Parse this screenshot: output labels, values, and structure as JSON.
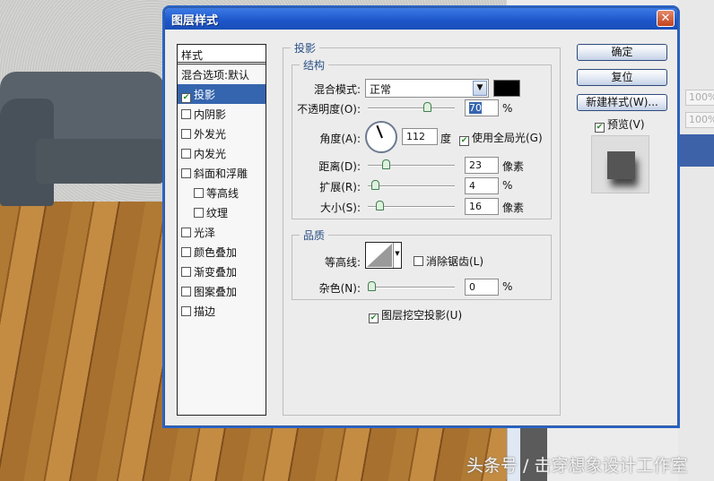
{
  "dialog": {
    "title": "图层样式",
    "close": "✕"
  },
  "styles_list": {
    "header": "样式",
    "items": [
      {
        "label": "混合选项:默认",
        "checkbox": false,
        "checked": false,
        "indent": false,
        "selected": false
      },
      {
        "label": "投影",
        "checkbox": true,
        "checked": true,
        "indent": false,
        "selected": true
      },
      {
        "label": "内阴影",
        "checkbox": true,
        "checked": false,
        "indent": false,
        "selected": false
      },
      {
        "label": "外发光",
        "checkbox": true,
        "checked": false,
        "indent": false,
        "selected": false
      },
      {
        "label": "内发光",
        "checkbox": true,
        "checked": false,
        "indent": false,
        "selected": false
      },
      {
        "label": "斜面和浮雕",
        "checkbox": true,
        "checked": false,
        "indent": false,
        "selected": false
      },
      {
        "label": "等高线",
        "checkbox": true,
        "checked": false,
        "indent": true,
        "selected": false
      },
      {
        "label": "纹理",
        "checkbox": true,
        "checked": false,
        "indent": true,
        "selected": false
      },
      {
        "label": "光泽",
        "checkbox": true,
        "checked": false,
        "indent": false,
        "selected": false
      },
      {
        "label": "颜色叠加",
        "checkbox": true,
        "checked": false,
        "indent": false,
        "selected": false
      },
      {
        "label": "渐变叠加",
        "checkbox": true,
        "checked": false,
        "indent": false,
        "selected": false
      },
      {
        "label": "图案叠加",
        "checkbox": true,
        "checked": false,
        "indent": false,
        "selected": false
      },
      {
        "label": "描边",
        "checkbox": true,
        "checked": false,
        "indent": false,
        "selected": false
      }
    ]
  },
  "drop_shadow": {
    "title": "投影",
    "structure": {
      "title": "结构",
      "blend_mode_label": "混合模式:",
      "blend_mode": "正常",
      "shadow_color": "#000000",
      "opacity_label": "不透明度(O):",
      "opacity": "70",
      "opacity_unit": "%",
      "opacity_frac": 0.7,
      "angle_label": "角度(A):",
      "angle": "112",
      "angle_unit": "度",
      "global_light_label": "使用全局光(G)",
      "global_light": true,
      "distance_label": "距离(D):",
      "distance": "23",
      "distance_unit": "像素",
      "distance_frac": 0.18,
      "spread_label": "扩展(R):",
      "spread": "4",
      "spread_unit": "%",
      "spread_frac": 0.04,
      "size_label": "大小(S):",
      "size": "16",
      "size_unit": "像素",
      "size_frac": 0.1
    },
    "quality": {
      "title": "品质",
      "contour_label": "等高线:",
      "anti_alias_label": "消除锯齿(L)",
      "anti_alias": false,
      "noise_label": "杂色(N):",
      "noise": "0",
      "noise_unit": "%",
      "noise_frac": 0
    },
    "knockout_label": "图层挖空投影(U)",
    "knockout": true
  },
  "buttons": {
    "ok": "确定",
    "reset": "复位",
    "new_style": "新建样式(W)...",
    "preview_label": "预览(V)",
    "preview": true
  },
  "right_panel": {
    "field1": "100%",
    "field2": "100%"
  },
  "watermark": "头条号 / 击穿想象设计工作室"
}
